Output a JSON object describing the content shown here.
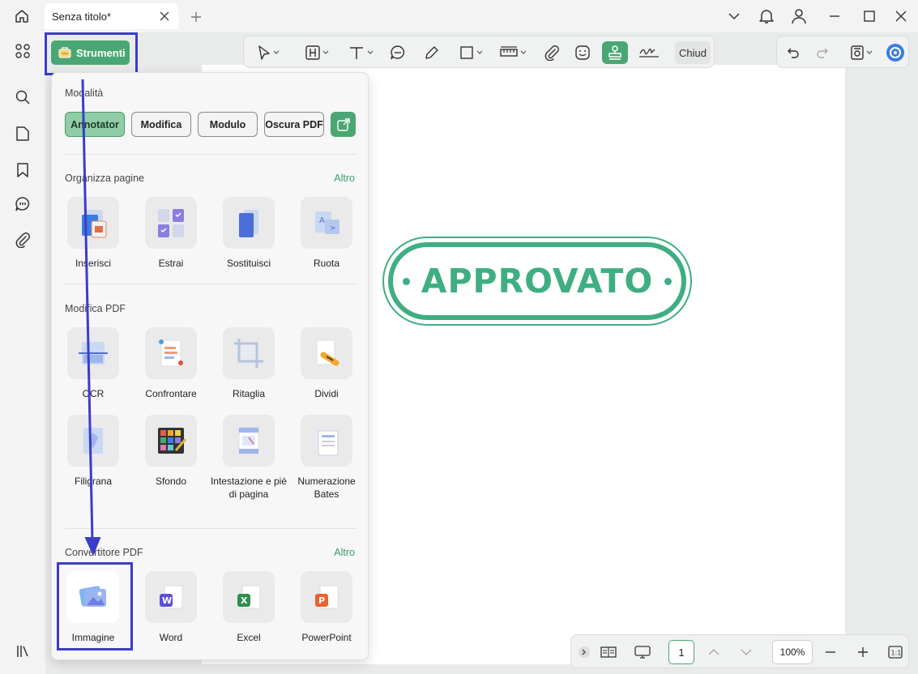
{
  "window": {
    "tab_title": "Senza titolo*"
  },
  "toolbar": {
    "close_label": "Chiud",
    "active_tool": "stamp-tool"
  },
  "strumenti": {
    "label": "Strumenti"
  },
  "panel": {
    "modes_title": "Modalità",
    "modes": [
      "Annotator",
      "Modifica",
      "Modulo",
      "Oscura PDF"
    ],
    "active_mode": "Annotator",
    "organize": {
      "title": "Organizza pagine",
      "more": "Altro",
      "items": [
        "Inserisci",
        "Estrai",
        "Sostituisci",
        "Ruota"
      ]
    },
    "edit": {
      "title": "Modifica PDF",
      "items": [
        "OCR",
        "Confrontare",
        "Ritaglia",
        "Dividi",
        "Filigrana",
        "Sfondo",
        "Intestazione e piè di pagina",
        "Numerazione Bates"
      ]
    },
    "convert": {
      "title": "Convertitore PDF",
      "more": "Altro",
      "items": [
        "Immagine",
        "Word",
        "Excel",
        "PowerPoint"
      ]
    }
  },
  "document": {
    "stamp_text": "APPROVATO"
  },
  "bottom": {
    "page_number": "1",
    "zoom": "100%",
    "fit_label": "1:1"
  },
  "colors": {
    "accent_green": "#4aa773",
    "stamp_green": "#3fae82",
    "highlight_blue": "#3b3dc8"
  }
}
